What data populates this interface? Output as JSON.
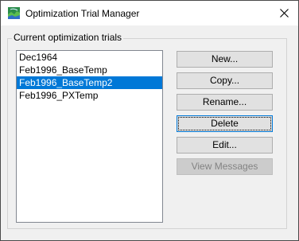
{
  "window": {
    "title": "Optimization Trial Manager",
    "icon": "app-icon",
    "close_icon": "close-icon"
  },
  "group": {
    "label": "Current optimization trials"
  },
  "trials": [
    {
      "label": "Dec1964",
      "selected": false
    },
    {
      "label": "Feb1996_BaseTemp",
      "selected": false
    },
    {
      "label": "Feb1996_BaseTemp2",
      "selected": true
    },
    {
      "label": "Feb1996_PXTemp",
      "selected": false
    }
  ],
  "buttons": {
    "new_label": "New...",
    "copy_label": "Copy...",
    "rename_label": "Rename...",
    "delete_label": "Delete",
    "edit_label": "Edit...",
    "view_messages_label": "View Messages"
  },
  "colors": {
    "selection": "#0078d7",
    "window_bg": "#f0f0f0",
    "disabled_text": "#838383"
  }
}
